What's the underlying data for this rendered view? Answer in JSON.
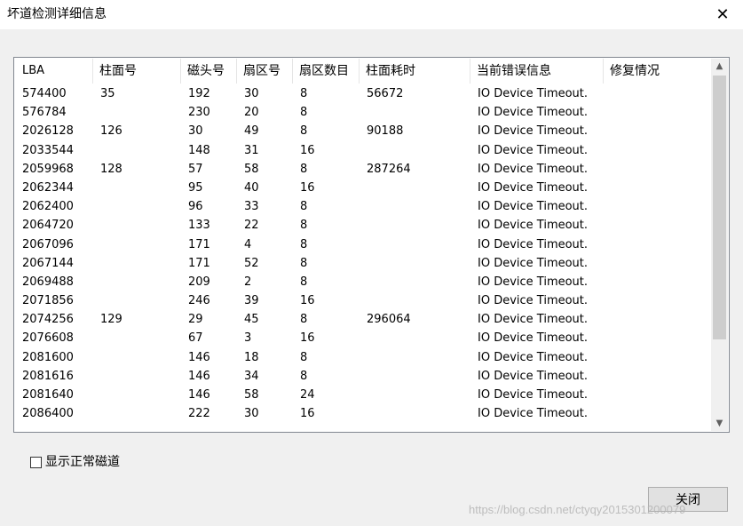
{
  "window": {
    "title": "坏道检测详细信息",
    "close_glyph": "✕"
  },
  "table": {
    "columns": [
      "LBA",
      "柱面号",
      "磁头号",
      "扇区号",
      "扇区数目",
      "柱面耗时",
      "当前错误信息",
      "修复情况"
    ],
    "rows": [
      [
        "574400",
        "35",
        "192",
        "30",
        "8",
        "56672",
        "IO Device Timeout.",
        ""
      ],
      [
        "576784",
        "",
        "230",
        "20",
        "8",
        "",
        "IO Device Timeout.",
        ""
      ],
      [
        "2026128",
        "126",
        "30",
        "49",
        "8",
        "90188",
        "IO Device Timeout.",
        ""
      ],
      [
        "2033544",
        "",
        "148",
        "31",
        "16",
        "",
        "IO Device Timeout.",
        ""
      ],
      [
        "2059968",
        "128",
        "57",
        "58",
        "8",
        "287264",
        "IO Device Timeout.",
        ""
      ],
      [
        "2062344",
        "",
        "95",
        "40",
        "16",
        "",
        "IO Device Timeout.",
        ""
      ],
      [
        "2062400",
        "",
        "96",
        "33",
        "8",
        "",
        "IO Device Timeout.",
        ""
      ],
      [
        "2064720",
        "",
        "133",
        "22",
        "8",
        "",
        "IO Device Timeout.",
        ""
      ],
      [
        "2067096",
        "",
        "171",
        "4",
        "8",
        "",
        "IO Device Timeout.",
        ""
      ],
      [
        "2067144",
        "",
        "171",
        "52",
        "8",
        "",
        "IO Device Timeout.",
        ""
      ],
      [
        "2069488",
        "",
        "209",
        "2",
        "8",
        "",
        "IO Device Timeout.",
        ""
      ],
      [
        "2071856",
        "",
        "246",
        "39",
        "16",
        "",
        "IO Device Timeout.",
        ""
      ],
      [
        "2074256",
        "129",
        "29",
        "45",
        "8",
        "296064",
        "IO Device Timeout.",
        ""
      ],
      [
        "2076608",
        "",
        "67",
        "3",
        "16",
        "",
        "IO Device Timeout.",
        ""
      ],
      [
        "2081600",
        "",
        "146",
        "18",
        "8",
        "",
        "IO Device Timeout.",
        ""
      ],
      [
        "2081616",
        "",
        "146",
        "34",
        "8",
        "",
        "IO Device Timeout.",
        ""
      ],
      [
        "2081640",
        "",
        "146",
        "58",
        "24",
        "",
        "IO Device Timeout.",
        ""
      ],
      [
        "2086400",
        "",
        "222",
        "30",
        "16",
        "",
        "IO Device Timeout.",
        ""
      ]
    ]
  },
  "scrollbar": {
    "up_glyph": "▲",
    "down_glyph": "▼",
    "position": 0.0
  },
  "show_normal_tracks": {
    "label": "显示正常磁道",
    "checked": false
  },
  "buttons": {
    "close_label": "关闭"
  },
  "watermark": "https://blog.csdn.net/ctyqy2015301200079"
}
